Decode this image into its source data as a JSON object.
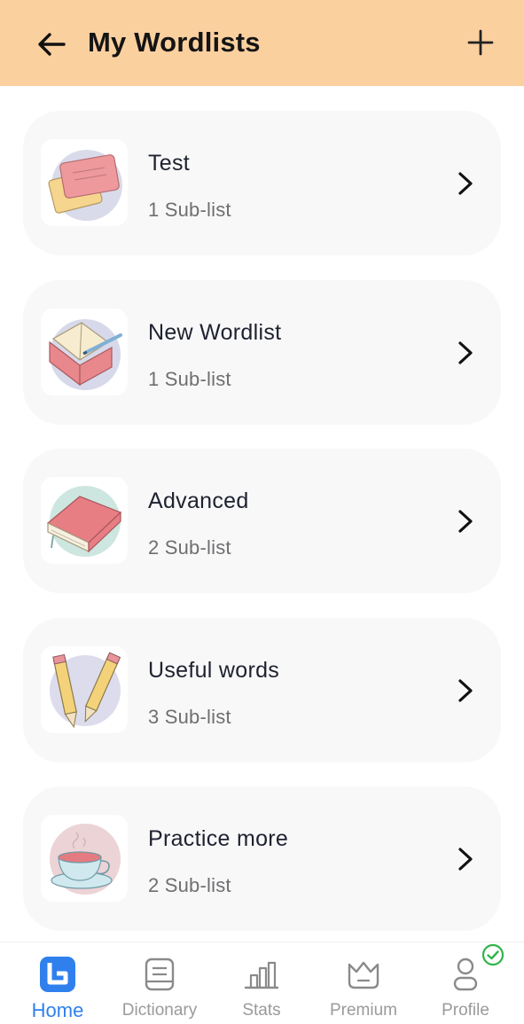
{
  "header": {
    "title": "My Wordlists",
    "back_icon": "arrow-left-icon",
    "add_icon": "plus-icon",
    "background": "#fbd09f"
  },
  "wordlists": [
    {
      "title": "Test",
      "subtitle": "1 Sub-list",
      "icon": "index-cards-icon"
    },
    {
      "title": "New Wordlist",
      "subtitle": "1 Sub-list",
      "icon": "notebook-pen-icon"
    },
    {
      "title": "Advanced",
      "subtitle": "2 Sub-list",
      "icon": "book-icon"
    },
    {
      "title": "Useful words",
      "subtitle": "3 Sub-list",
      "icon": "pencils-icon"
    },
    {
      "title": "Practice more",
      "subtitle": "2 Sub-list",
      "icon": "teacup-icon"
    }
  ],
  "bottom_nav": {
    "items": [
      {
        "label": "Home",
        "icon": "home-logo-icon",
        "active": true
      },
      {
        "label": "Dictionary",
        "icon": "book-icon"
      },
      {
        "label": "Stats",
        "icon": "bar-chart-icon"
      },
      {
        "label": "Premium",
        "icon": "crown-icon"
      },
      {
        "label": "Profile",
        "icon": "person-icon"
      }
    ],
    "active_color": "#2f80ed",
    "inactive_color": "#9a9a9a",
    "profile_badge_icon": "check-circle-icon",
    "profile_badge_color": "#2fb34a"
  }
}
